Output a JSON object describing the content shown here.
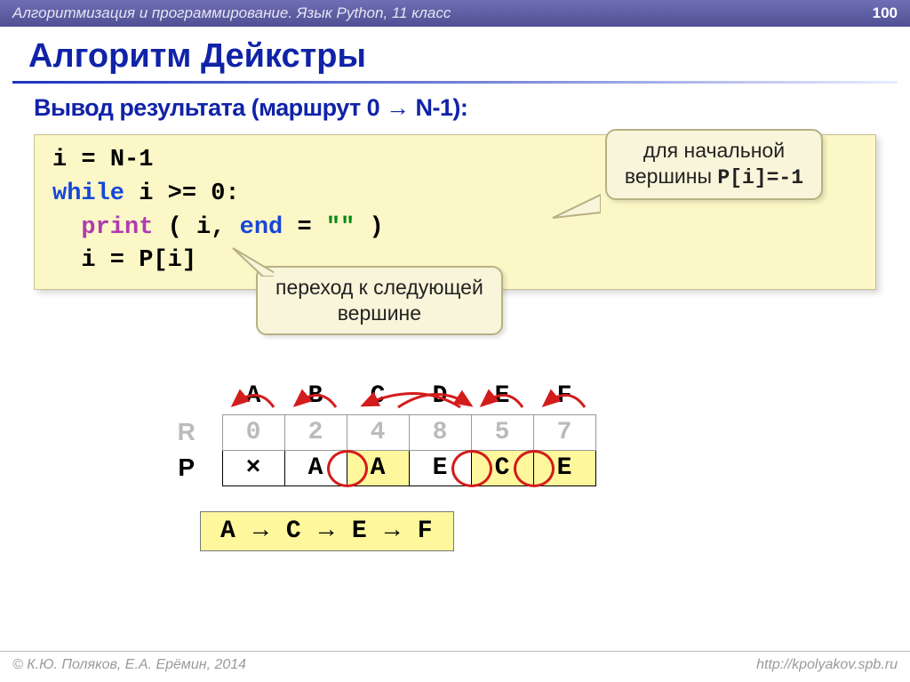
{
  "topbar": {
    "breadcrumb": "Алгоритмизация и программирование. Язык Python, 11 класс",
    "page": "100"
  },
  "title": "Алгоритм Дейкстры",
  "subtitle": "Вывод результата (маршрут 0 → N-1):",
  "code": {
    "l1_var": "i",
    "l1_eq": " = ",
    "l1_rhs": "N-1",
    "l2_kw": "while",
    "l2_rest": " i >= 0:",
    "l3_func": "print",
    "l3_open": " ( i, ",
    "l3_end": "end",
    "l3_eq2": " = ",
    "l3_str": "\"\"",
    "l3_close": " )",
    "l4": "i = P[i]"
  },
  "callouts": {
    "top_l1": "для начальной",
    "top_l2a": "вершины ",
    "top_l2b": "P[i]=-1",
    "bottom_l1": "переход к следующей",
    "bottom_l2": "вершине"
  },
  "table": {
    "headers": [
      "A",
      "B",
      "C",
      "D",
      "E",
      "F"
    ],
    "r_label": "R",
    "r": [
      "0",
      "2",
      "4",
      "8",
      "5",
      "7"
    ],
    "p_label": "P",
    "p": [
      "×",
      "A",
      "A",
      "E",
      "C",
      "E"
    ]
  },
  "route": "A → C → E → F",
  "footer": {
    "authors": "© К.Ю. Поляков, Е.А. Ерёмин, 2014",
    "url": "http://kpolyakov.spb.ru"
  }
}
